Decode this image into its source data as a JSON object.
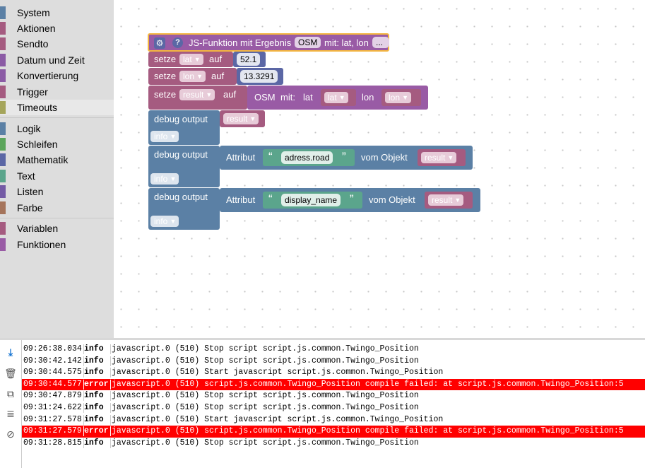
{
  "toolbox": {
    "categories": [
      {
        "label": "System",
        "color": "#5b80a5"
      },
      {
        "label": "Aktionen",
        "color": "#a55b80"
      },
      {
        "label": "Sendto",
        "color": "#a55b80"
      },
      {
        "label": "Datum und Zeit",
        "color": "#8b5ba5"
      },
      {
        "label": "Konvertierung",
        "color": "#8b5ba5"
      },
      {
        "label": "Trigger",
        "color": "#a55b80"
      },
      {
        "label": "Timeouts",
        "color": "#a5a55b"
      },
      {
        "label": "Logik",
        "color": "#5b80a5"
      },
      {
        "label": "Schleifen",
        "color": "#5ba55b"
      },
      {
        "label": "Mathematik",
        "color": "#5b67a5"
      },
      {
        "label": "Text",
        "color": "#5ba58c"
      },
      {
        "label": "Listen",
        "color": "#745ba5"
      },
      {
        "label": "Farbe",
        "color": "#a5745b"
      },
      {
        "label": "Variablen",
        "color": "#a55b80"
      },
      {
        "label": "Funktionen",
        "color": "#995ba5"
      }
    ]
  },
  "workspace": {
    "function_header": {
      "title": "JS-Funktion mit Ergebnis",
      "name": "OSM",
      "params_text": "mit: lat, lon",
      "more": "..."
    },
    "set_lat": {
      "keyword": "setze",
      "var": "lat",
      "to": "auf",
      "value": "52.1"
    },
    "set_lon": {
      "keyword": "setze",
      "var": "lon",
      "to": "auf",
      "value": "13.3291"
    },
    "set_result": {
      "keyword": "setze",
      "var": "result",
      "to": "auf",
      "call": "OSM",
      "call_with": "mit:",
      "arg1_label": "lat",
      "arg1_var": "lat",
      "arg2_label": "lon",
      "arg2_var": "lon"
    },
    "debug1": {
      "label": "debug output",
      "var": "result",
      "level": "info"
    },
    "debug2": {
      "label": "debug output",
      "attr": "Attribut",
      "quote_open": "“",
      "quote_close": "”",
      "key": "adress.road",
      "from": "vom Objekt",
      "var": "result",
      "level": "info"
    },
    "debug3": {
      "label": "debug output",
      "attr": "Attribut",
      "quote_open": "“",
      "quote_close": "”",
      "key": "display_name",
      "from": "vom Objekt",
      "var": "result",
      "level": "info"
    }
  },
  "colors": {
    "variables": "#a55b80",
    "math": "#5b67a5",
    "text": "#5ba58c",
    "system": "#5b80a5",
    "funcs": "#995ba5",
    "error": "#ff0000",
    "header_border": "#f4b63f"
  },
  "log": {
    "rows": [
      {
        "time": "09:26:38.034",
        "severity": "info",
        "msg": "javascript.0 (510) Stop script script.js.common.Twingo_Position"
      },
      {
        "time": "09:30:42.142",
        "severity": "info",
        "msg": "javascript.0 (510) Stop script script.js.common.Twingo_Position"
      },
      {
        "time": "09:30:44.575",
        "severity": "info",
        "msg": "javascript.0 (510) Start javascript script.js.common.Twingo_Position"
      },
      {
        "time": "09:30:44.577",
        "severity": "error",
        "msg": "javascript.0 (510) script.js.common.Twingo_Position compile failed: at script.js.common.Twingo_Position:5"
      },
      {
        "time": "09:30:47.879",
        "severity": "info",
        "msg": "javascript.0 (510) Stop script script.js.common.Twingo_Position"
      },
      {
        "time": "09:31:24.622",
        "severity": "info",
        "msg": "javascript.0 (510) Stop script script.js.common.Twingo_Position"
      },
      {
        "time": "09:31:27.578",
        "severity": "info",
        "msg": "javascript.0 (510) Start javascript script.js.common.Twingo_Position"
      },
      {
        "time": "09:31:27.579",
        "severity": "error",
        "msg": "javascript.0 (510) script.js.common.Twingo_Position compile failed: at script.js.common.Twingo_Position:5"
      },
      {
        "time": "09:31:28.815",
        "severity": "info",
        "msg": "javascript.0 (510) Stop script script.js.common.Twingo_Position"
      }
    ],
    "tools": [
      {
        "icon": "scroll-down-icon",
        "glyph": "⤓"
      },
      {
        "icon": "delete-icon",
        "glyph": "🗑"
      },
      {
        "icon": "copy-icon",
        "glyph": "⧉"
      },
      {
        "icon": "details-icon",
        "glyph": "≣"
      },
      {
        "icon": "visibility-off-icon",
        "glyph": "⊘"
      }
    ]
  }
}
